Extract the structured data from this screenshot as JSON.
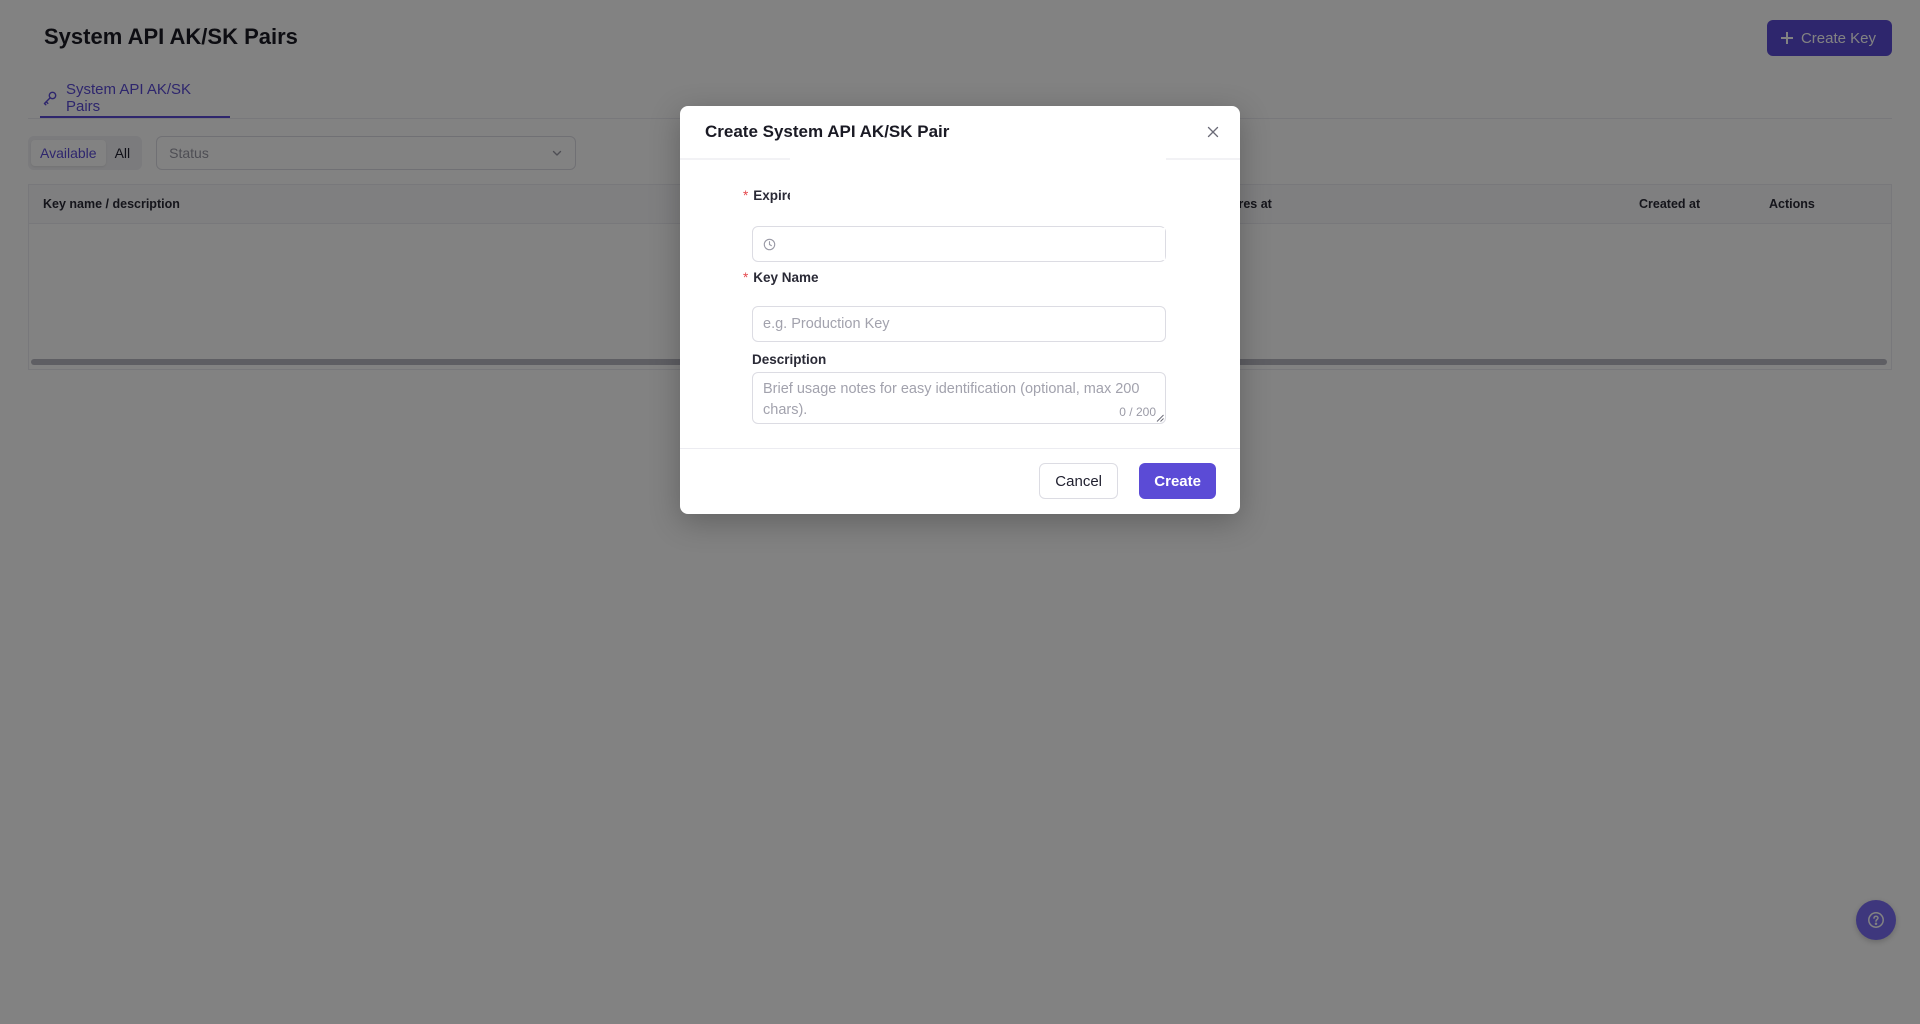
{
  "page": {
    "title": "System API AK/SK Pairs",
    "create_key_label": "Create Key"
  },
  "tabs": [
    {
      "label": "System API AK/SK Pairs",
      "icon": "key-icon",
      "active": true
    }
  ],
  "filters": {
    "segments": [
      {
        "label": "Available",
        "active": true
      },
      {
        "label": "All",
        "active": false
      }
    ],
    "status_placeholder": "Status"
  },
  "table": {
    "columns": [
      "Key name / description",
      "Expires at",
      "Created at",
      "Actions"
    ],
    "expires_visible_fragment": "ires at"
  },
  "modal": {
    "title": "Create System API AK/SK Pair",
    "fields": {
      "expire": {
        "label": "Expire",
        "required": true
      },
      "key_name": {
        "label": "Key Name",
        "required": true,
        "placeholder": "e.g. Production Key"
      },
      "description": {
        "label": "Description",
        "required": false,
        "placeholder": "Brief usage notes for easy identification (optional, max 200 chars).",
        "counter": "0 / 200"
      }
    },
    "cancel_label": "Cancel",
    "create_label": "Create"
  },
  "colors": {
    "accent": "#5b4bd6",
    "help_button": "#7b6cf6",
    "required": "#e5484d",
    "overlay": "rgba(0,0,0,0.49)"
  },
  "icons": {
    "tab": "key-icon",
    "create": "plus-icon",
    "close": "close-icon",
    "expire": "clock-icon",
    "status": "chevron-down-icon",
    "help": "help-icon"
  }
}
